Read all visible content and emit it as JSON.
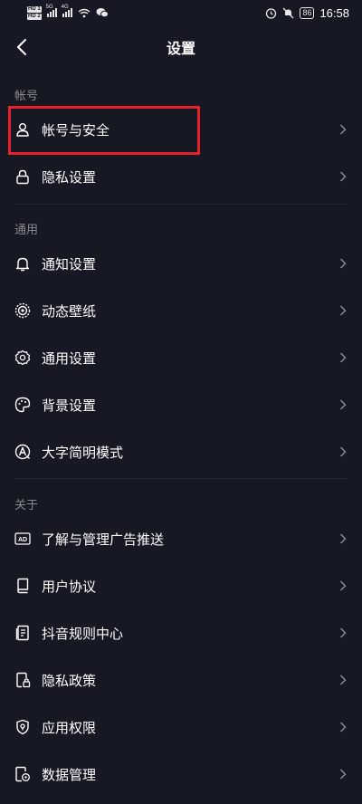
{
  "status_bar": {
    "hd1": "HD 1",
    "hd2": "HD 2",
    "sig1": "5G",
    "sig2": "4G",
    "battery": "86",
    "time": "16:58"
  },
  "header": {
    "title": "设置"
  },
  "sections": [
    {
      "label": "帐号",
      "items": [
        {
          "label": "帐号与安全",
          "icon": "person-icon"
        },
        {
          "label": "隐私设置",
          "icon": "lock-icon"
        }
      ]
    },
    {
      "label": "通用",
      "items": [
        {
          "label": "通知设置",
          "icon": "bell-icon"
        },
        {
          "label": "动态壁纸",
          "icon": "wallpaper-icon"
        },
        {
          "label": "通用设置",
          "icon": "gear-icon"
        },
        {
          "label": "背景设置",
          "icon": "palette-icon"
        },
        {
          "label": "大字简明模式",
          "icon": "large-text-icon"
        }
      ]
    },
    {
      "label": "关于",
      "items": [
        {
          "label": "了解与管理广告推送",
          "icon": "ad-icon"
        },
        {
          "label": "用户协议",
          "icon": "book-icon"
        },
        {
          "label": "抖音规则中心",
          "icon": "rules-icon"
        },
        {
          "label": "隐私政策",
          "icon": "privacy-doc-icon"
        },
        {
          "label": "应用权限",
          "icon": "shield-icon"
        },
        {
          "label": "数据管理",
          "icon": "data-icon"
        }
      ]
    }
  ],
  "colors": {
    "background": "#161823",
    "highlight": "#e8202a",
    "section_label": "#8a8b91"
  }
}
